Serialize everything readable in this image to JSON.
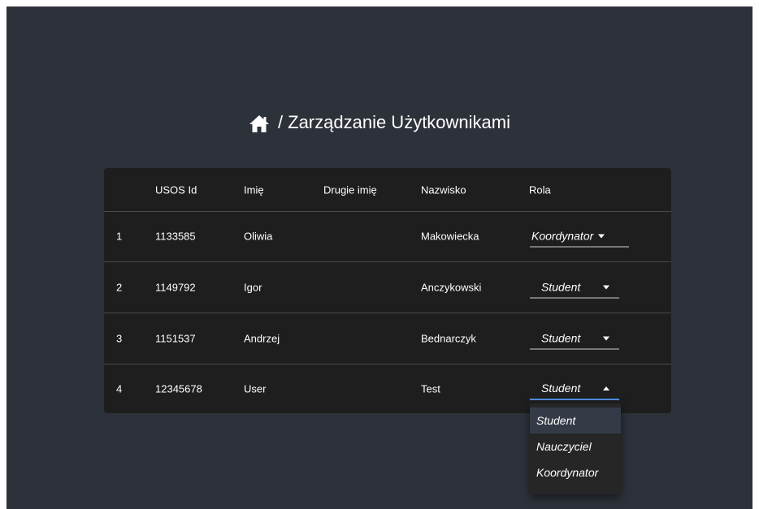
{
  "breadcrumb": {
    "home_icon": "home-icon",
    "separator": "/",
    "title": "Zarządzanie Użytkownikami"
  },
  "table": {
    "headers": {
      "index": "",
      "usos_id": "USOS Id",
      "first_name": "Imię",
      "middle_name": "Drugie imię",
      "last_name": "Nazwisko",
      "role": "Rola"
    },
    "rows": [
      {
        "index": "1",
        "usos_id": "1133585",
        "first_name": "Oliwia",
        "middle_name": "",
        "last_name": "Makowiecka",
        "role": "Koordynator"
      },
      {
        "index": "2",
        "usos_id": "1149792",
        "first_name": "Igor",
        "middle_name": "",
        "last_name": "Anczykowski",
        "role": "Student"
      },
      {
        "index": "3",
        "usos_id": "1151537",
        "first_name": "Andrzej",
        "middle_name": "",
        "last_name": "Bednarczyk",
        "role": "Student"
      },
      {
        "index": "4",
        "usos_id": "12345678",
        "first_name": "User",
        "middle_name": "",
        "last_name": "Test",
        "role": "Student"
      }
    ]
  },
  "role_dropdown": {
    "open_for_row": "4",
    "options": [
      "Student",
      "Nauczyciel",
      "Koordynator"
    ],
    "selected": "Student"
  },
  "colors": {
    "background": "#2d313a",
    "table_bg": "#1e1e1e",
    "focus_underline": "#4f8de0"
  }
}
